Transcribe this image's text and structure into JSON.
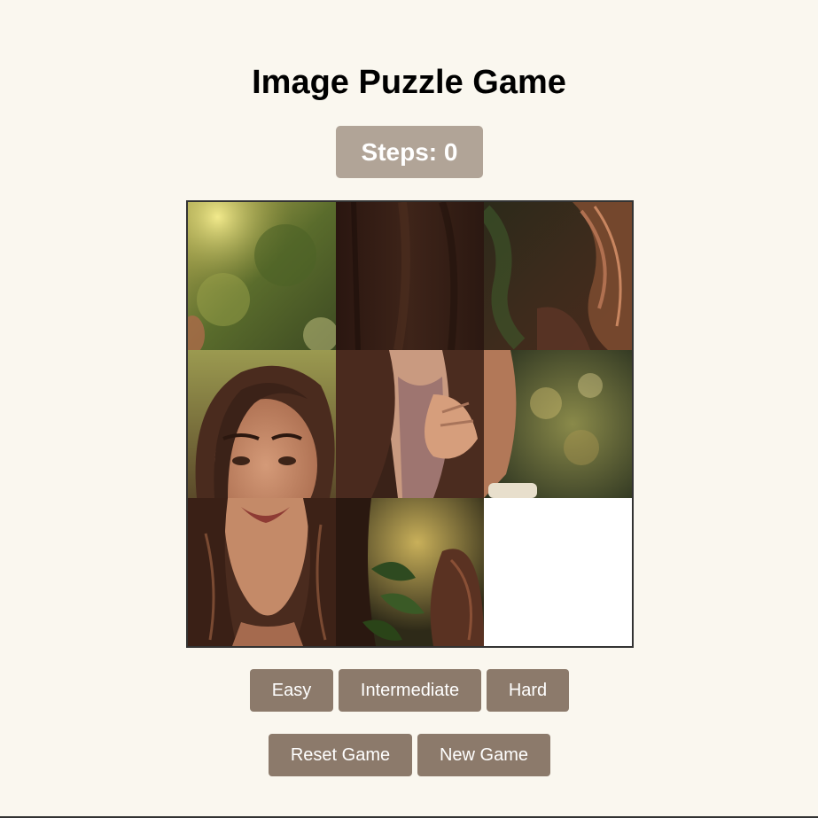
{
  "game": {
    "title": "Image Puzzle Game",
    "steps_label": "Steps: 0"
  },
  "controls": {
    "difficulty": [
      "Easy",
      "Intermediate",
      "Hard"
    ],
    "actions": [
      "Reset Game",
      "New Game"
    ]
  },
  "board": {
    "grid": "3x3",
    "tiles": [
      "green-bokeh-left",
      "dark-sweater",
      "hair-with-leaves",
      "smiling-girl-face",
      "hand-on-sweater",
      "bokeh-with-cup",
      "girl-chin-and-hair",
      "leaves-and-hair",
      "empty"
    ]
  },
  "colors": {
    "background": "#faf7ef",
    "steps_badge": "#b1a497",
    "button": "#8c7a6b",
    "button_text": "#ffffff"
  }
}
